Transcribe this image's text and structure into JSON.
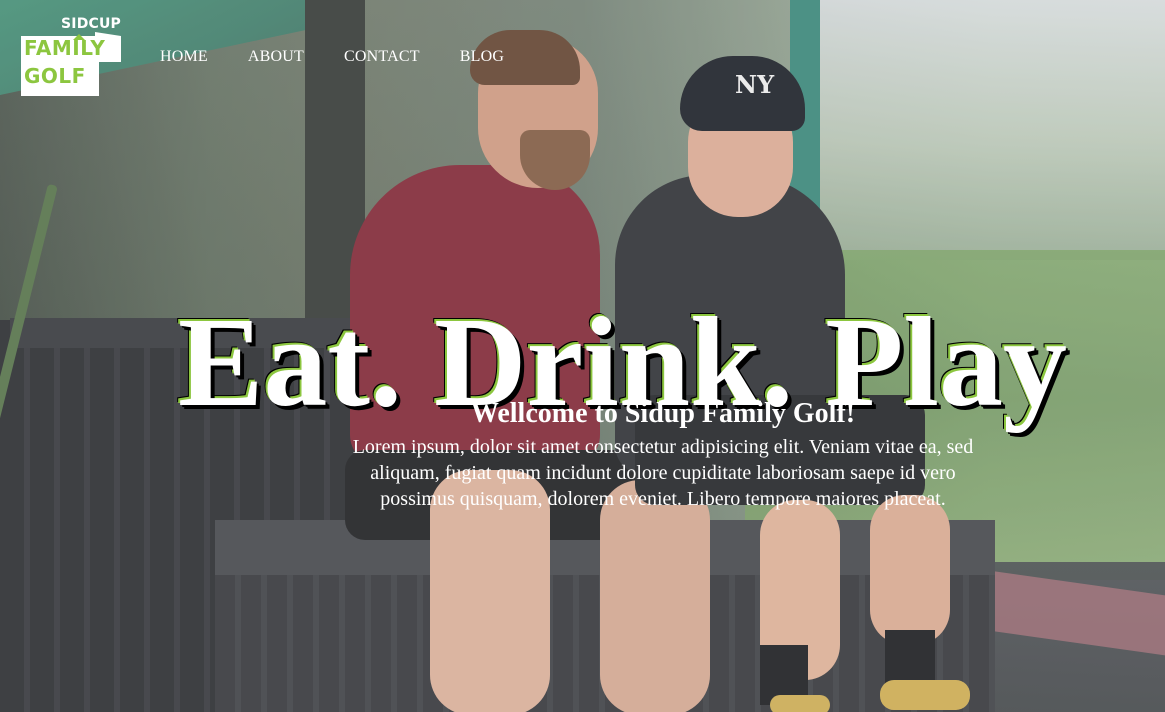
{
  "logo": {
    "top_text": "SIDCUP",
    "line1": "FAMILY",
    "line2": "GOLF",
    "badge_color": "#ffffff",
    "accent_color": "#8cc63f"
  },
  "nav": {
    "items": [
      {
        "label": "HOME"
      },
      {
        "label": "ABOUT"
      },
      {
        "label": "CONTACT"
      },
      {
        "label": "BLOG"
      }
    ]
  },
  "hero": {
    "title": "Eat. Drink. Play",
    "title_outline_color": "#8cc63f",
    "cap_logo": "NY"
  },
  "welcome": {
    "heading": "Wellcome to Sidup Family Golf!",
    "text": "Lorem ipsum, dolor sit amet consectetur adipisicing elit. Veniam vitae ea, sed aliquam, fugiat quam incidunt dolore cupiditate laboriosam saepe id vero possimus quisquam, dolorem eveniet. Libero tempore maiores placeat."
  }
}
